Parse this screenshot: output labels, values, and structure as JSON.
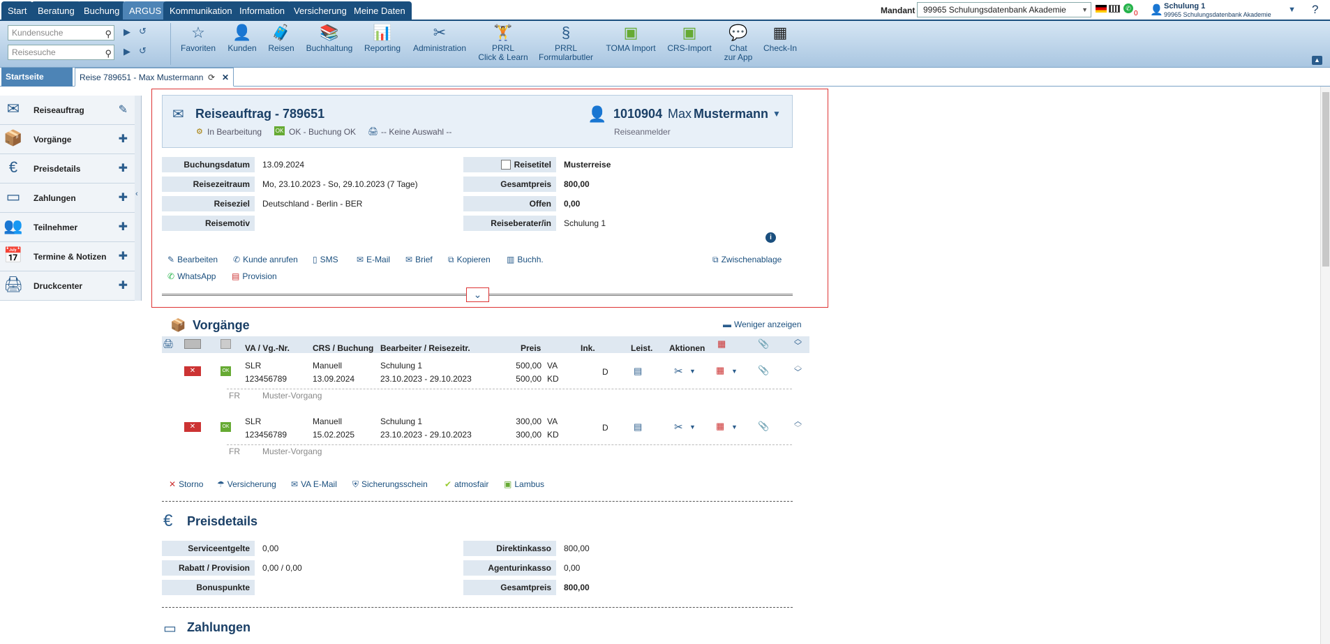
{
  "nav": {
    "tabs": [
      "Start",
      "Beratung",
      "Buchung",
      "ARGUS",
      "Kommunikation",
      "Information",
      "Versicherung",
      "Meine Daten"
    ],
    "active": "ARGUS",
    "mandant_label": "Mandant",
    "mandant_value": "99965 Schulungsdatenbank Akademie",
    "whatsapp_badge": "0",
    "user_name": "Schulung 1",
    "user_org": "99965 Schulungsdatenbank Akademie",
    "help": "?"
  },
  "search": {
    "kunde_placeholder": "Kundensuche",
    "reise_placeholder": "Reisesuche"
  },
  "toolbar": [
    {
      "id": "favoriten",
      "line1": "Favoriten",
      "line2": "",
      "icon": "star-icon"
    },
    {
      "id": "kunden",
      "line1": "Kunden",
      "line2": "",
      "icon": "person-icon"
    },
    {
      "id": "reisen",
      "line1": "Reisen",
      "line2": "",
      "icon": "suitcase-icon"
    },
    {
      "id": "buchhaltung",
      "line1": "Buchhaltung",
      "line2": "",
      "icon": "books-icon"
    },
    {
      "id": "reporting",
      "line1": "Reporting",
      "line2": "",
      "icon": "report-icon"
    },
    {
      "id": "administration",
      "line1": "Administration",
      "line2": "",
      "icon": "tools-icon"
    },
    {
      "id": "prrl-click",
      "line1": "PRRL",
      "line2": "Click & Learn",
      "icon": "prrl-icon"
    },
    {
      "id": "prrl-form",
      "line1": "PRRL",
      "line2": "Formularbutler",
      "icon": "paragraph-icon"
    },
    {
      "id": "toma",
      "line1": "TOMA Import",
      "line2": "",
      "icon": "import-icon"
    },
    {
      "id": "crs",
      "line1": "CRS-Import",
      "line2": "",
      "icon": "import-icon"
    },
    {
      "id": "chat",
      "line1": "Chat",
      "line2": "zur App",
      "icon": "chat-icon"
    },
    {
      "id": "checkin",
      "line1": "Check-In",
      "line2": "",
      "icon": "qr-icon"
    }
  ],
  "tabs": {
    "home": "Startseite",
    "current": "Reise 789651 - Max Mustermann"
  },
  "sidebar": [
    {
      "label": "Reiseauftrag",
      "action": "✎",
      "icon": "envelope-icon"
    },
    {
      "label": "Vorgänge",
      "action": "✚",
      "icon": "boxes-icon"
    },
    {
      "label": "Preisdetails",
      "action": "✚",
      "icon": "euro-icon"
    },
    {
      "label": "Zahlungen",
      "action": "✚",
      "icon": "card-icon"
    },
    {
      "label": "Teilnehmer",
      "action": "✚",
      "icon": "people-icon"
    },
    {
      "label": "Termine & Notizen",
      "action": "✚",
      "icon": "calendar-icon"
    },
    {
      "label": "Druckcenter",
      "action": "✚",
      "icon": "printer-icon"
    }
  ],
  "order": {
    "title": "Reiseauftrag - 789651",
    "status1": "In Bearbeitung",
    "status2": "OK - Buchung OK",
    "status3": "-- Keine Auswahl --",
    "customer_no": "1010904",
    "customer_first": "Max",
    "customer_last": "Mustermann",
    "customer_role": "Reiseanmelder",
    "fields_left": [
      {
        "label": "Buchungsdatum",
        "value": "13.09.2024"
      },
      {
        "label": "Reisezeitraum",
        "value": "Mo, 23.10.2023 - So, 29.10.2023 (7 Tage)"
      },
      {
        "label": "Reiseziel",
        "value": "Deutschland - Berlin - BER"
      },
      {
        "label": "Reisemotiv",
        "value": ""
      }
    ],
    "fields_right": [
      {
        "label": "Reisetitel",
        "value": "Musterreise"
      },
      {
        "label": "Gesamtpreis",
        "value": "800,00"
      },
      {
        "label": "Offen",
        "value": "0,00"
      },
      {
        "label": "Reiseberater/in",
        "value": "Schulung 1"
      }
    ],
    "actions": [
      "Bearbeiten",
      "Kunde anrufen",
      "SMS",
      "E-Mail",
      "Brief",
      "Kopieren",
      "Buchh."
    ],
    "actions2": [
      "WhatsApp",
      "Provision"
    ],
    "clipboard": "Zwischenablage"
  },
  "vorgaenge": {
    "title": "Vorgänge",
    "less": "Weniger anzeigen",
    "headers": {
      "va": "VA / Vg.-Nr.",
      "crs": "CRS / Buchung",
      "bearb": "Bearbeiter / Reisezeitr.",
      "preis": "Preis",
      "ink": "Ink.",
      "leist": "Leist.",
      "aktionen": "Aktionen"
    },
    "rows": [
      {
        "va": "SLR",
        "nr": "123456789",
        "crs": "Manuell",
        "date": "13.09.2024",
        "bearb": "Schulung 1",
        "zeitraum": "23.10.2023 - 29.10.2023",
        "preis1": "500,00",
        "typ1": "VA",
        "preis2": "500,00",
        "typ2": "KD",
        "ink": "D",
        "fr": "FR",
        "desc": "Muster-Vorgang"
      },
      {
        "va": "SLR",
        "nr": "123456789",
        "crs": "Manuell",
        "date": "15.02.2025",
        "bearb": "Schulung 1",
        "zeitraum": "23.10.2023 - 29.10.2023",
        "preis1": "300,00",
        "typ1": "VA",
        "preis2": "300,00",
        "typ2": "KD",
        "ink": "D",
        "fr": "FR",
        "desc": "Muster-Vorgang"
      }
    ],
    "bottom_actions": [
      "Storno",
      "Versicherung",
      "VA E-Mail",
      "Sicherungsschein",
      "atmosfair",
      "Lambus"
    ]
  },
  "preisdetails": {
    "title": "Preisdetails",
    "left": [
      {
        "label": "Serviceentgelte",
        "value": "0,00"
      },
      {
        "label": "Rabatt / Provision",
        "value": "0,00 / 0,00"
      },
      {
        "label": "Bonuspunkte",
        "value": ""
      }
    ],
    "right": [
      {
        "label": "Direktinkasso",
        "value": "800,00"
      },
      {
        "label": "Agenturinkasso",
        "value": "0,00"
      },
      {
        "label": "Gesamtpreis",
        "value": "800,00"
      }
    ]
  },
  "zahlungen": {
    "title": "Zahlungen"
  }
}
